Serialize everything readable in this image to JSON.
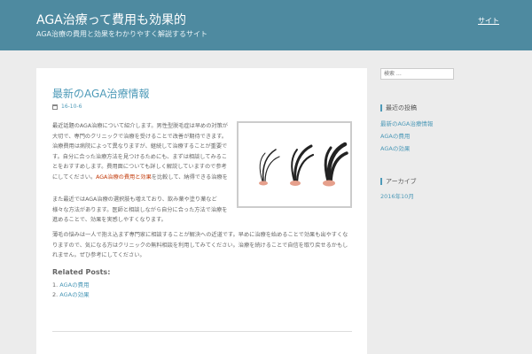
{
  "header": {
    "site_title": "AGA治療って費用も効果的",
    "site_description": "AGA治療の費用と効果をわかりやすく解説するサイト",
    "menu_link": "サイト"
  },
  "post": {
    "title": "最新のAGA治療情報",
    "date": "16-10-6",
    "paragraph1_a": "最近話題のAGA治療について紹介します。男性型脱毛症は早めの対策が大切で、専門のクリニックで治療を受けることで改善が期待できます。治療費用は病院によって異なりますが、継続して治療することが重要です。自分に合った治療方法を見つけるためにも、まずは相談してみることをおすすめします。費用面についても詳しく解説していますので参考にしてください。",
    "paragraph1_highlight": "AGA治療の費用と効果",
    "paragraph1_b": "を比較して、納得できる治療を選ぶことが大切です。無料カウンセリングを活用しましょう。",
    "paragraph2": "また最近ではAGA治療の選択肢も増えており、飲み薬や塗り薬など様々な方法があります。医師と相談しながら自分に合った方法で治療を進めることで、効果を実感しやすくなります。",
    "paragraph3": "薄毛の悩みは一人で抱え込まず専門家に相談することが解決への近道です。早めに治療を始めることで効果も出やすくなりますので、気になる方はクリニックの無料相談を利用してみてください。治療を続けることで自信を取り戻せるかもしれません。ぜひ参考にしてください。",
    "related_heading": "Related Posts:",
    "related": [
      {
        "num": "1.",
        "label": "AGAの費用"
      },
      {
        "num": "2.",
        "label": "AGAの効果"
      }
    ],
    "image_alt": "hair growth illustration"
  },
  "sidebar": {
    "search_placeholder": "検索 …",
    "recent_title": "最近の投稿",
    "recent_items": [
      "最新のAGA治療情報",
      "AGAの費用",
      "AGAの効果"
    ],
    "archive_title": "アーカイブ",
    "archive_items": [
      "2016年10月"
    ]
  },
  "colors": {
    "header_bg": "#4e8aa0",
    "link": "#4e9ab8",
    "highlight": "#c23a0a"
  }
}
